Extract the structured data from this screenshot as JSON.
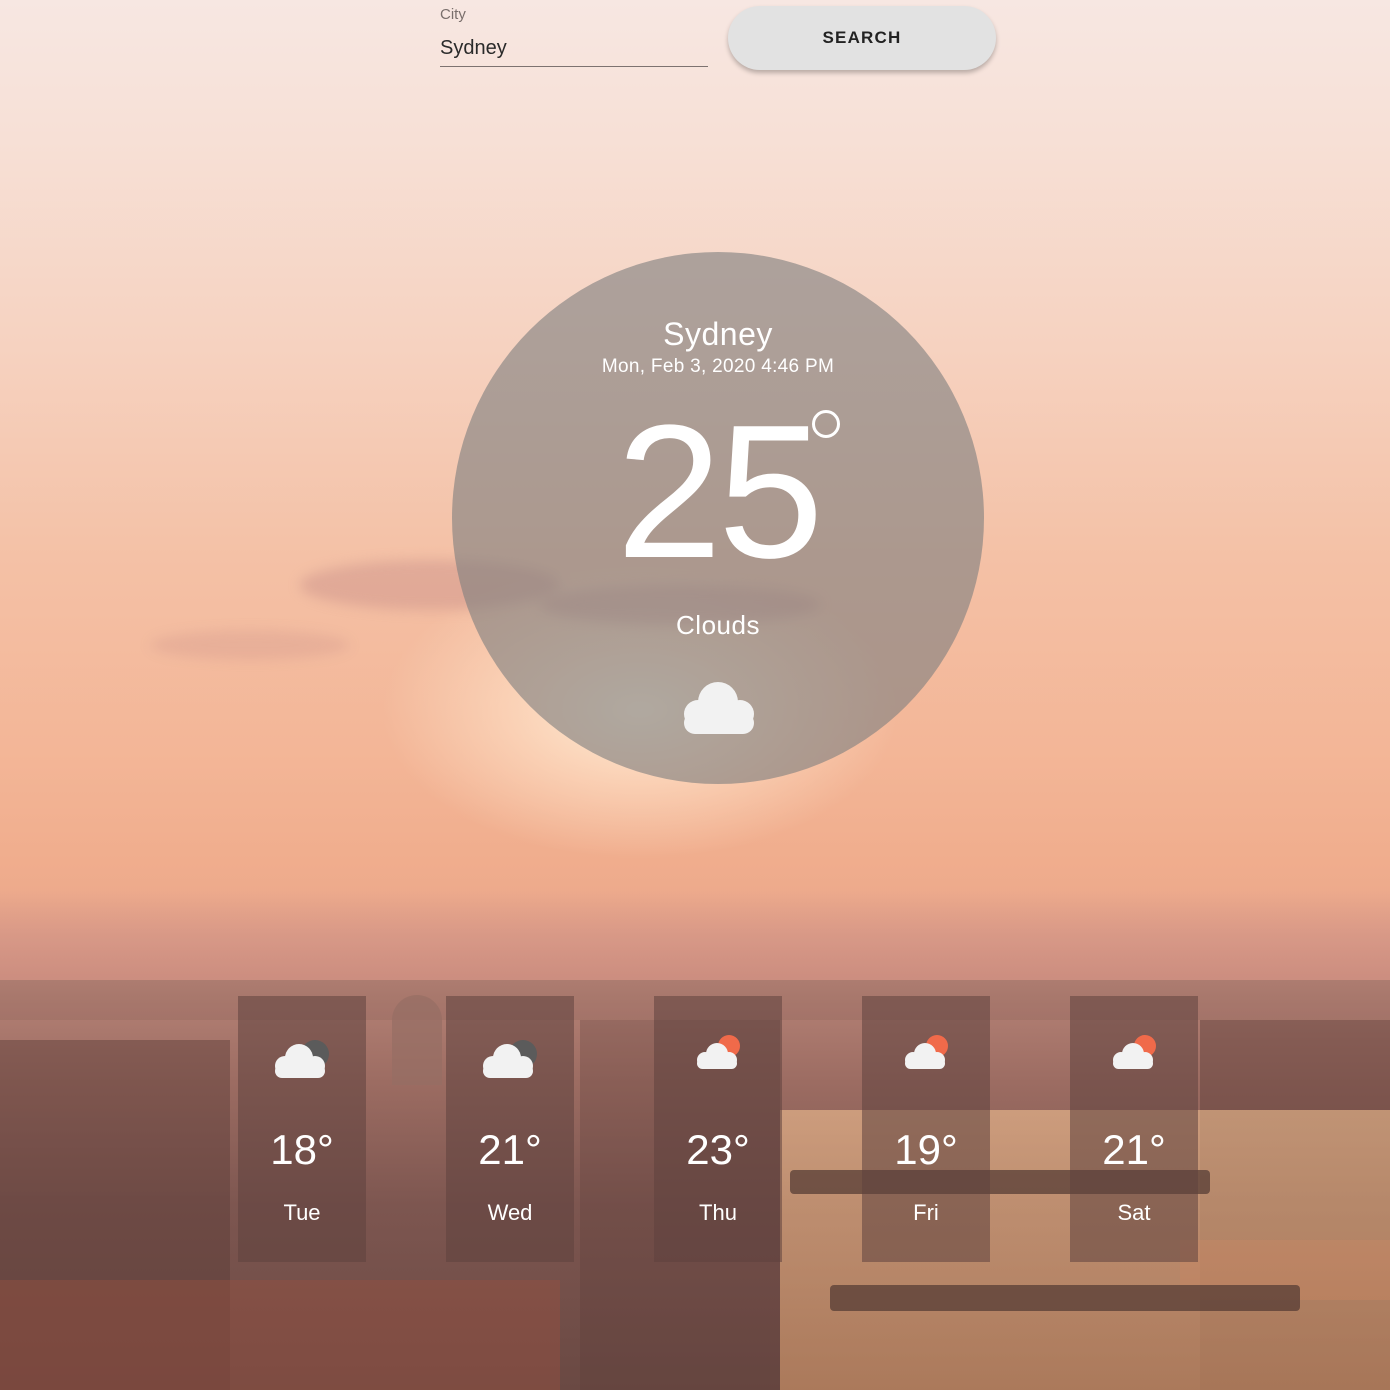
{
  "search": {
    "label": "City",
    "value": "Sydney",
    "button_label": "SEARCH"
  },
  "current": {
    "city": "Sydney",
    "datetime": "Mon, Feb 3, 2020 4:46 PM",
    "temperature": "25",
    "condition": "Clouds",
    "icon": "cloud-icon"
  },
  "forecast": [
    {
      "temp": "18°",
      "day": "Tue",
      "icon": "cloud-moon-icon"
    },
    {
      "temp": "21°",
      "day": "Wed",
      "icon": "cloud-moon-icon"
    },
    {
      "temp": "23°",
      "day": "Thu",
      "icon": "cloud-sun-icon"
    },
    {
      "temp": "19°",
      "day": "Fri",
      "icon": "cloud-sun-icon"
    },
    {
      "temp": "21°",
      "day": "Sat",
      "icon": "cloud-sun-icon"
    }
  ],
  "colors": {
    "sun_accent": "#f06a4a",
    "circle_bg": "#808080",
    "card_bg": "#5f413e"
  }
}
